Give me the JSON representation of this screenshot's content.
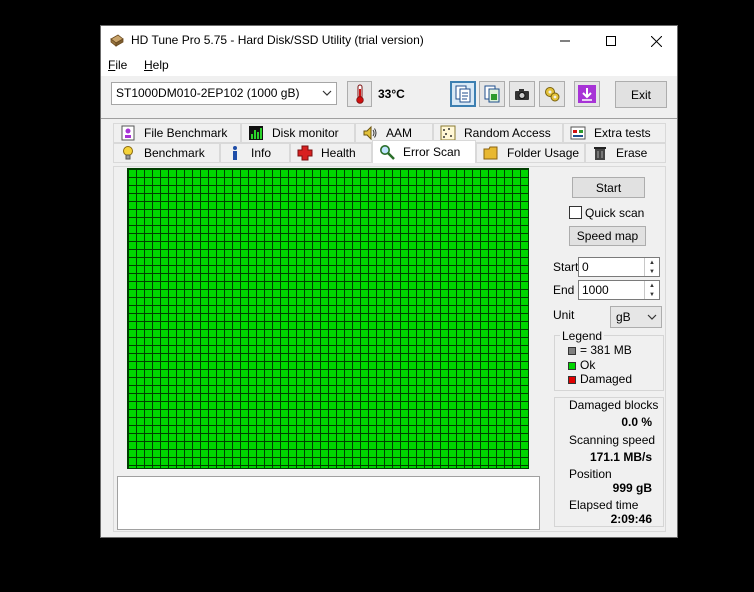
{
  "window": {
    "title": "HD Tune Pro 5.75 - Hard Disk/SSD Utility (trial version)"
  },
  "menu": {
    "file_accel": "F",
    "file_rest": "ile",
    "help_accel": "H",
    "help_rest": "elp"
  },
  "toolbar": {
    "drive": "ST1000DM010-2EP102 (1000 gB)",
    "temperature": "33°C",
    "exit_label": "Exit"
  },
  "tabs": {
    "row1": [
      "File Benchmark",
      "Disk monitor",
      "AAM",
      "Random Access",
      "Extra tests"
    ],
    "row2": [
      "Benchmark",
      "Info",
      "Health",
      "Error Scan",
      "Folder Usage",
      "Erase"
    ],
    "selected": "Error Scan"
  },
  "scan": {
    "start_button": "Start",
    "quick_scan_label": "Quick scan",
    "quick_scan_checked": false,
    "speed_map_button": "Speed map",
    "start_label": "Start",
    "start_value": "0",
    "end_label": "End",
    "end_value": "1000",
    "unit_label": "Unit",
    "unit_value": "gB"
  },
  "legend": {
    "title": "Legend",
    "block_size": "= 381 MB",
    "ok": "Ok",
    "damaged": "Damaged",
    "colors": {
      "block": "#808080",
      "ok": "#00d600",
      "damaged": "#e00000"
    }
  },
  "stats": {
    "damaged_blocks_label": "Damaged blocks",
    "damaged_blocks_value": "0.0 %",
    "scanning_speed_label": "Scanning speed",
    "scanning_speed_value": "171.1 MB/s",
    "position_label": "Position",
    "position_value": "999 gB",
    "elapsed_label": "Elapsed time",
    "elapsed_value": "2:09:46"
  }
}
